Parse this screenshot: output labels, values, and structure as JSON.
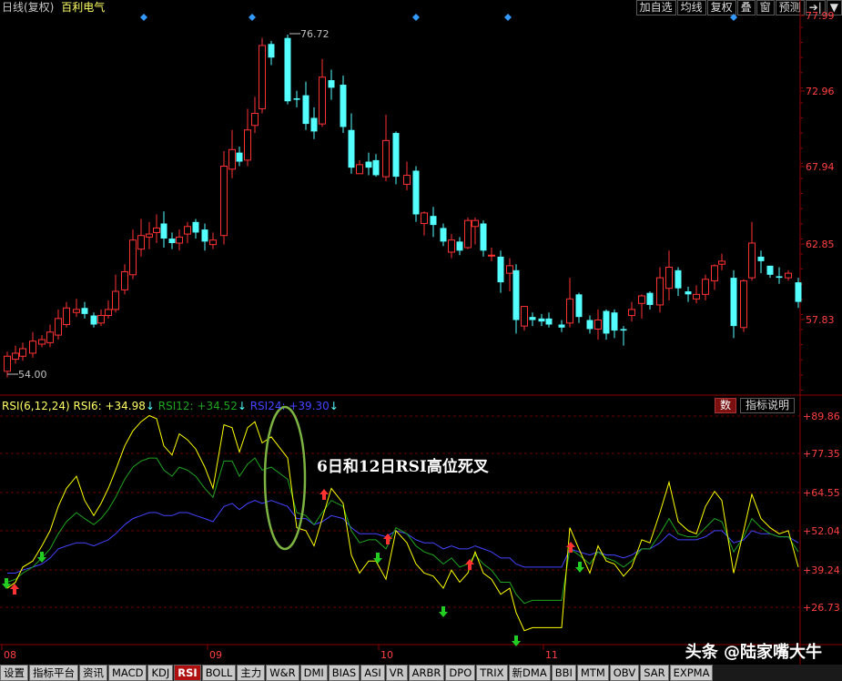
{
  "topbar": {
    "period": "日线(复权)",
    "stock_name": "百利电气"
  },
  "toolbar": [
    {
      "label": "加自选",
      "name": "add-watchlist-button"
    },
    {
      "label": "均线",
      "name": "ma-button"
    },
    {
      "label": "复权",
      "name": "adjust-button"
    },
    {
      "label": "叠",
      "name": "overlay-button"
    },
    {
      "label": "窗",
      "name": "window-button"
    },
    {
      "label": "预测",
      "name": "forecast-button"
    },
    {
      "label": "➔|",
      "name": "next-button"
    },
    {
      "label": "▼",
      "name": "dropdown-button"
    }
  ],
  "price_axis": [
    "77.99",
    "72.96",
    "67.94",
    "62.85",
    "57.83"
  ],
  "price_annotations": {
    "high": "76.72",
    "low": "54.00"
  },
  "rsi": {
    "title": "RSI(6,12,24)",
    "rsi6": "RSI6: +34.98",
    "rsi12": "RSI12: +34.52",
    "rsi24": "RSI24: +39.30",
    "axis": [
      "+89.86",
      "+77.35",
      "+64.55",
      "+52.04",
      "+39.24",
      "+26.73"
    ]
  },
  "rsi_buttons": {
    "shu": "数",
    "explain": "指标说明"
  },
  "annotation": "6日和12日RSI高位死叉",
  "date_axis": [
    "08",
    "09",
    "10",
    "11"
  ],
  "tabs": [
    "设置",
    "指标平台",
    "资讯",
    "MACD",
    "KDJ",
    "RSI",
    "BOLL",
    "主力",
    "W&R",
    "DMI",
    "BIAS",
    "ASI",
    "VR",
    "ARBR",
    "DPO",
    "TRIX",
    "新DMA",
    "BBI",
    "MTM",
    "OBV",
    "SAR",
    "EXPMA"
  ],
  "active_tab": "RSI",
  "watermark": "头条 @陆家嘴大牛",
  "colors": {
    "up": "#ff3232",
    "down": "#54ffff",
    "rsi6": "#ffff00",
    "rsi12": "#1fa51f",
    "rsi24": "#4444ff",
    "grid": "#8b0000",
    "circle": "#7cb342"
  }
}
